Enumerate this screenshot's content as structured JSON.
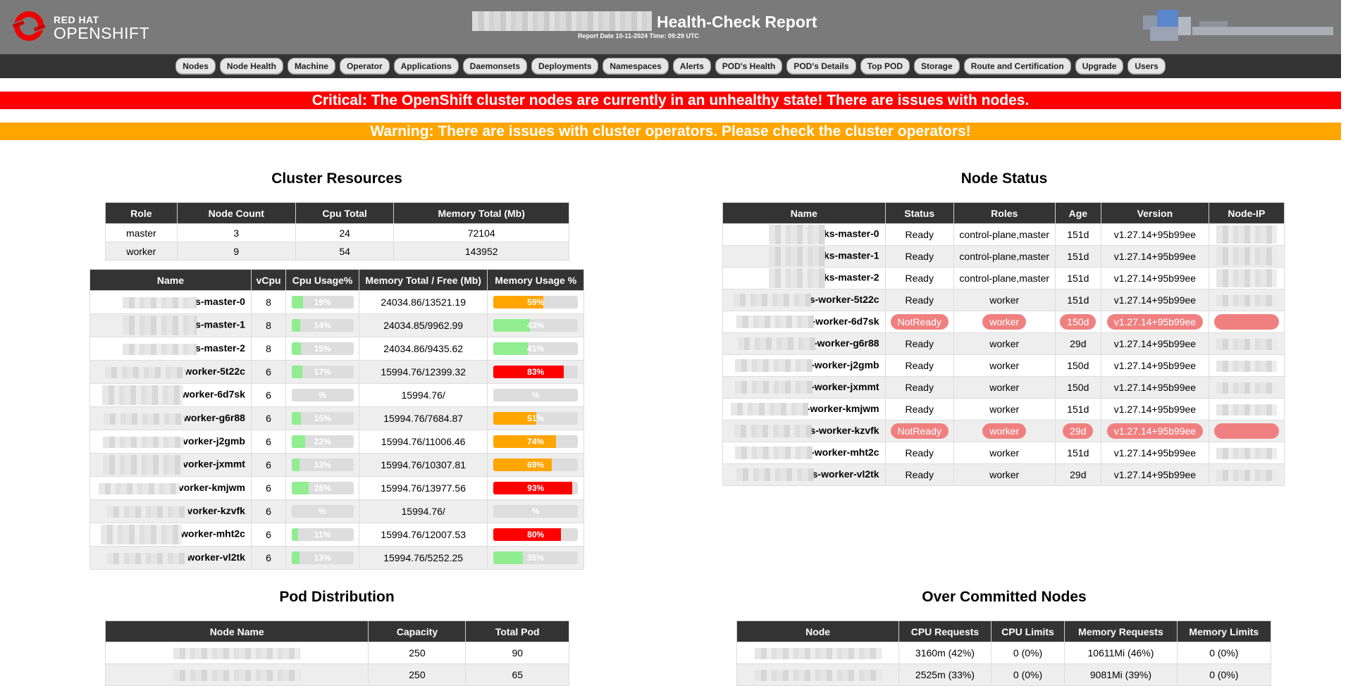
{
  "header": {
    "logo_line1": "RED HAT",
    "logo_line2": "OPENSHIFT",
    "title": "Health-Check Report",
    "report_date": "Report Date 10-11-2024 Time: 09:29 UTC"
  },
  "nav": [
    "Nodes",
    "Node Health",
    "Machine",
    "Operator",
    "Applications",
    "Daemonsets",
    "Deployments",
    "Namespaces",
    "Alerts",
    "POD's Health",
    "POD's Details",
    "Top POD",
    "Storage",
    "Route and Certification",
    "Upgrade",
    "Users"
  ],
  "alerts": {
    "critical": "Critical: The OpenShift cluster nodes are currently in an unhealthy state! There are issues with nodes.",
    "warning": "Warning: There are issues with cluster operators. Please check the cluster operators!"
  },
  "colors": {
    "header_bg": "#7a7a7a",
    "nav_bg": "#333333",
    "critical": "#ff0000",
    "warning": "#ffa500",
    "ok": "#90ee90",
    "danger": "#ff0000",
    "caution": "#ffa500",
    "notready_pill": "#f08080"
  },
  "cluster_resources": {
    "title": "Cluster Resources",
    "headers": [
      "Role",
      "Node Count",
      "Cpu Total",
      "Memory Total (Mb)"
    ],
    "rows": [
      [
        "master",
        "3",
        "24",
        "72104"
      ],
      [
        "worker",
        "9",
        "54",
        "143952"
      ]
    ]
  },
  "node_usage": {
    "headers": [
      "Name",
      "vCpu",
      "Cpu Usage%",
      "Memory Total / Free (Mb)",
      "Memory Usage %"
    ],
    "rows": [
      {
        "name": "s-master-0",
        "vcpu": "8",
        "cpu": 19,
        "cpu_label": "19%",
        "mem": "24034.86/13521.19",
        "mem_pct": 59,
        "mem_label": "59%"
      },
      {
        "name": "s-master-1",
        "vcpu": "8",
        "cpu": 14,
        "cpu_label": "14%",
        "mem": "24034.85/9962.99",
        "mem_pct": 43,
        "mem_label": "43%"
      },
      {
        "name": "s-master-2",
        "vcpu": "8",
        "cpu": 15,
        "cpu_label": "15%",
        "mem": "24034.86/9435.62",
        "mem_pct": 41,
        "mem_label": "41%"
      },
      {
        "name": "worker-5t22c",
        "vcpu": "6",
        "cpu": 17,
        "cpu_label": "17%",
        "mem": "15994.76/12399.32",
        "mem_pct": 83,
        "mem_label": "83%"
      },
      {
        "name": "worker-6d7sk",
        "vcpu": "6",
        "cpu": 0,
        "cpu_label": "%",
        "mem": "15994.76/",
        "mem_pct": 0,
        "mem_label": "%"
      },
      {
        "name": "worker-g6r88",
        "vcpu": "6",
        "cpu": 15,
        "cpu_label": "15%",
        "mem": "15994.76/7684.87",
        "mem_pct": 51,
        "mem_label": "51%"
      },
      {
        "name": "vorker-j2gmb",
        "vcpu": "6",
        "cpu": 22,
        "cpu_label": "22%",
        "mem": "15994.76/11006.46",
        "mem_pct": 74,
        "mem_label": "74%"
      },
      {
        "name": "vorker-jxmmt",
        "vcpu": "6",
        "cpu": 13,
        "cpu_label": "13%",
        "mem": "15994.76/10307.81",
        "mem_pct": 69,
        "mem_label": "69%"
      },
      {
        "name": "vorker-kmjwm",
        "vcpu": "6",
        "cpu": 28,
        "cpu_label": "28%",
        "mem": "15994.76/13977.56",
        "mem_pct": 93,
        "mem_label": "93%"
      },
      {
        "name": "vorker-kzvfk",
        "vcpu": "6",
        "cpu": 0,
        "cpu_label": "%",
        "mem": "15994.76/",
        "mem_pct": 0,
        "mem_label": "%"
      },
      {
        "name": "worker-mht2c",
        "vcpu": "6",
        "cpu": 11,
        "cpu_label": "11%",
        "mem": "15994.76/12007.53",
        "mem_pct": 80,
        "mem_label": "80%"
      },
      {
        "name": "worker-vl2tk",
        "vcpu": "6",
        "cpu": 13,
        "cpu_label": "13%",
        "mem": "15994.76/5252.25",
        "mem_pct": 35,
        "mem_label": "35%"
      }
    ]
  },
  "node_status": {
    "title": "Node Status",
    "headers": [
      "Name",
      "Status",
      "Roles",
      "Age",
      "Version",
      "Node-IP"
    ],
    "rows": [
      {
        "name": "ks-master-0",
        "status": "Ready",
        "roles": "control-plane,master",
        "age": "151d",
        "version": "v1.27.14+95b99ee",
        "bad": false
      },
      {
        "name": "ks-master-1",
        "status": "Ready",
        "roles": "control-plane,master",
        "age": "151d",
        "version": "v1.27.14+95b99ee",
        "bad": false
      },
      {
        "name": "ks-master-2",
        "status": "Ready",
        "roles": "control-plane,master",
        "age": "151d",
        "version": "v1.27.14+95b99ee",
        "bad": false
      },
      {
        "name": "s-worker-5t22c",
        "status": "Ready",
        "roles": "worker",
        "age": "151d",
        "version": "v1.27.14+95b99ee",
        "bad": false
      },
      {
        "name": "-worker-6d7sk",
        "status": "NotReady",
        "roles": "worker",
        "age": "150d",
        "version": "v1.27.14+95b99ee",
        "bad": true
      },
      {
        "name": "-worker-g6r88",
        "status": "Ready",
        "roles": "worker",
        "age": "29d",
        "version": "v1.27.14+95b99ee",
        "bad": false
      },
      {
        "name": "-worker-j2gmb",
        "status": "Ready",
        "roles": "worker",
        "age": "150d",
        "version": "v1.27.14+95b99ee",
        "bad": false
      },
      {
        "name": "-worker-jxmmt",
        "status": "Ready",
        "roles": "worker",
        "age": "150d",
        "version": "v1.27.14+95b99ee",
        "bad": false
      },
      {
        "name": "-worker-kmjwm",
        "status": "Ready",
        "roles": "worker",
        "age": "151d",
        "version": "v1.27.14+95b99ee",
        "bad": false
      },
      {
        "name": "s-worker-kzvfk",
        "status": "NotReady",
        "roles": "worker",
        "age": "29d",
        "version": "v1.27.14+95b99ee",
        "bad": true
      },
      {
        "name": "-worker-mht2c",
        "status": "Ready",
        "roles": "worker",
        "age": "151d",
        "version": "v1.27.14+95b99ee",
        "bad": false
      },
      {
        "name": "s-worker-vl2tk",
        "status": "Ready",
        "roles": "worker",
        "age": "29d",
        "version": "v1.27.14+95b99ee",
        "bad": false
      }
    ]
  },
  "pod_distribution": {
    "title": "Pod Distribution",
    "headers": [
      "Node Name",
      "Capacity",
      "Total Pod"
    ],
    "rows": [
      [
        "",
        "250",
        "90"
      ],
      [
        "",
        "250",
        "65"
      ]
    ]
  },
  "over_committed": {
    "title": "Over Committed Nodes",
    "headers": [
      "Node",
      "CPU Requests",
      "CPU Limits",
      "Memory Requests",
      "Memory Limits"
    ],
    "rows": [
      [
        "",
        "3160m (42%)",
        "0 (0%)",
        "10611Mi (46%)",
        "0 (0%)"
      ],
      [
        "",
        "2525m (33%)",
        "0 (0%)",
        "9081Mi (39%)",
        "0 (0%)"
      ]
    ]
  }
}
